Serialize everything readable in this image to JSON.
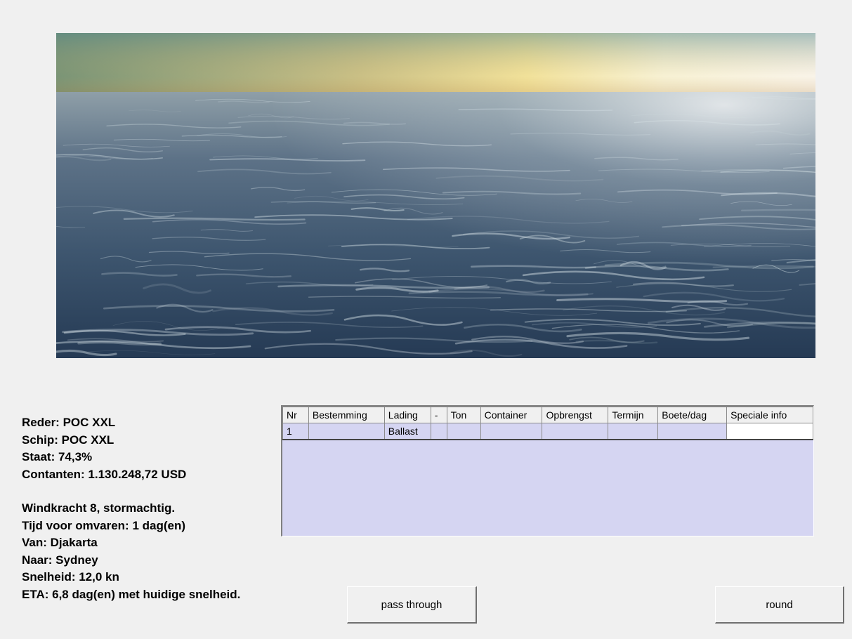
{
  "scene": {
    "description_icon": "ocean-waves-scene"
  },
  "info": {
    "reder": "Reder: POC XXL",
    "schip": "Schip: POC XXL",
    "staat": "Staat: 74,3%",
    "contanten": "Contanten: 1.130.248,72 USD",
    "windkracht": "Windkracht 8, stormachtig.",
    "tijd": "Tijd voor omvaren: 1 dag(en)",
    "van": "Van: Djakarta",
    "naar": "Naar: Sydney",
    "snelheid": "Snelheid: 12,0 kn",
    "eta": "ETA: 6,8 dag(en) met huidige snelheid."
  },
  "cargo_table": {
    "headers": [
      "Nr",
      "Bestemming",
      "Lading",
      "-",
      "Ton",
      "Container",
      "Opbrengst",
      "Termijn",
      "Boete/dag",
      "Speciale info"
    ],
    "rows": [
      [
        "1",
        "",
        "Ballast",
        "",
        "",
        "",
        "",
        "",
        "",
        ""
      ]
    ]
  },
  "buttons": {
    "pass_through": "pass through",
    "round": "round"
  }
}
